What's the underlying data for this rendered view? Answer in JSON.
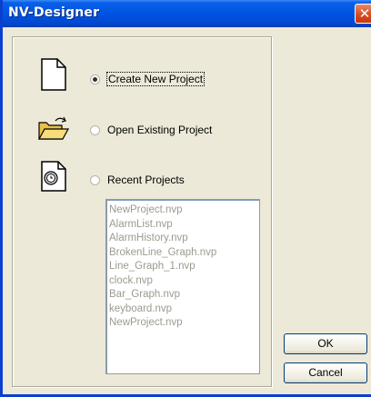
{
  "window": {
    "title": "NV-Designer",
    "close_glyph": "✕"
  },
  "options": [
    {
      "label": "Create New Project",
      "selected": true,
      "icon": "new-document-icon"
    },
    {
      "label": "Open Existing Project",
      "selected": false,
      "icon": "open-folder-icon"
    },
    {
      "label": "Recent Projects",
      "selected": false,
      "icon": "recent-document-icon"
    }
  ],
  "recent_projects": [
    "NewProject.nvp",
    "AlarmList.nvp",
    "AlarmHistory.nvp",
    "BrokenLine_Graph.nvp",
    "Line_Graph_1.nvp",
    "clock.nvp",
    "Bar_Graph.nvp",
    "keyboard.nvp",
    "NewProject.nvp"
  ],
  "buttons": {
    "ok": "OK",
    "cancel": "Cancel"
  },
  "colors": {
    "titlebar": "#0054e3",
    "dialog_bg": "#ece9d8",
    "list_text_disabled": "#9c9a8f"
  }
}
